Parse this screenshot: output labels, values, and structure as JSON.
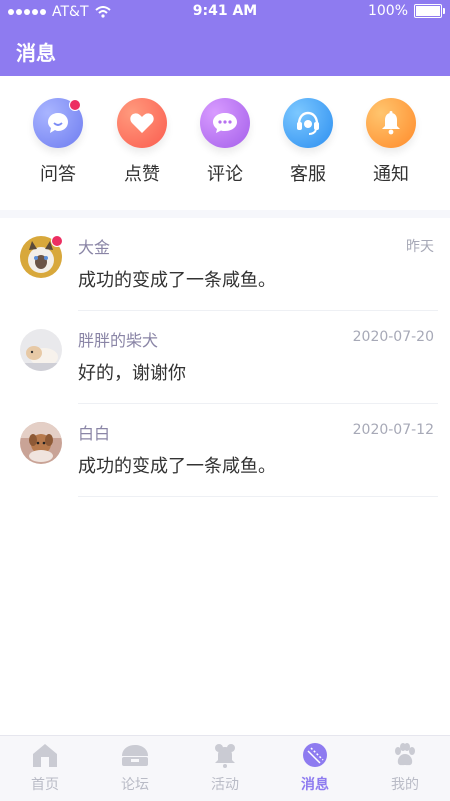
{
  "status": {
    "carrier": "AT&T",
    "time": "9:41 AM",
    "battery": "100%"
  },
  "header": {
    "title": "消息"
  },
  "shortcuts": [
    {
      "label": "问答",
      "icon": "chat-bubble-icon",
      "color": "#7B8CF5",
      "badge": true
    },
    {
      "label": "点赞",
      "icon": "heart-icon",
      "color": "#FF6E5E",
      "badge": false
    },
    {
      "label": "评论",
      "icon": "comment-icon",
      "color": "#B66FF0",
      "badge": false
    },
    {
      "label": "客服",
      "icon": "headset-icon",
      "color": "#35A6F5",
      "badge": false
    },
    {
      "label": "通知",
      "icon": "bell-icon",
      "color": "#FF9A3E",
      "badge": false
    }
  ],
  "messages": [
    {
      "name": "大金",
      "time": "昨天",
      "text": "成功的变成了一条咸鱼。",
      "unread": true
    },
    {
      "name": "胖胖的柴犬",
      "time": "2020-07-20",
      "text": "好的，谢谢你",
      "unread": false
    },
    {
      "name": "白白",
      "time": "2020-07-12",
      "text": "成功的变成了一条咸鱼。",
      "unread": false
    }
  ],
  "tabs": [
    {
      "label": "首页",
      "icon": "home-icon",
      "active": false
    },
    {
      "label": "论坛",
      "icon": "forum-icon",
      "active": false
    },
    {
      "label": "活动",
      "icon": "activity-icon",
      "active": false
    },
    {
      "label": "消息",
      "icon": "message-icon",
      "active": true
    },
    {
      "label": "我的",
      "icon": "paw-icon",
      "active": false
    }
  ],
  "colors": {
    "accent": "#8E7BF0",
    "badge": "#EC2E62",
    "tab_inactive": "#B9BBC6"
  }
}
